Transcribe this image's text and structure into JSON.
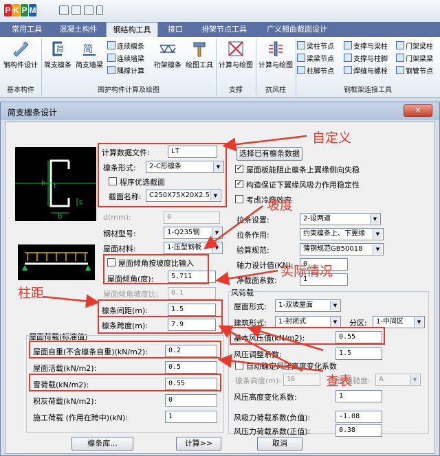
{
  "app": {
    "logo_letters": [
      "P",
      "K",
      "P",
      "M"
    ],
    "logo_colors": [
      "#d8262b",
      "#f4a21a",
      "#2d8d3a",
      "#1d5fb1"
    ],
    "tabs": [
      "常用工具",
      "混凝土构件",
      "钢结构工具",
      "接口",
      "排架节点工具",
      "广义翘曲截面设计"
    ],
    "active_tab": "钢结构工具"
  },
  "ribbon": {
    "buttons": {
      "steel_design": "钢构件设计",
      "simple_purlin": "简支檩条",
      "simple_wall_beam": "简支墙梁",
      "truss_purlin": "桁架檩条",
      "drawing_tool": "绘图工具",
      "calc_draw_1": "计算与绘图",
      "calc_draw_2": "计算与绘图"
    },
    "small_buttons": {
      "cont_purlin": "连续檩条",
      "cont_wall_beam": "连续墙梁",
      "corner_calc": "隅撑计算",
      "beam_col": "梁柱节点",
      "brace_beam": "支撑与梁柱",
      "portal_col": "门架梁柱",
      "beam_beam": "梁梁节点",
      "brace_foot": "支撑与柱脚",
      "portal_beam": "门架梁梁",
      "col_foot": "柱脚节点",
      "weld_bolt": "焊缝与螺栓",
      "steel_tube": "钢管节点"
    },
    "groups": [
      "基本构件",
      "围护构件计算及绘图",
      "支撑",
      "抗风柱",
      "钢框架连接工具"
    ]
  },
  "dialog": {
    "title": "简支檩条设计",
    "close": "✕",
    "preview": {
      "dim_b": "b",
      "dim_t": "t",
      "dim_h": "h",
      "dim_c": "c"
    },
    "calc_file_label": "计算数据文件:",
    "calc_file_value": "LT",
    "select_purlin_button": "选择已有檩条数据",
    "purlin_form_label": "檩条形式:",
    "purlin_form_value": "2-C形檩条",
    "optimize_section_label": "程序优选截面",
    "section_name_label": "截面名称:",
    "section_name_value": "C250X75X20X2.5",
    "roof_panel_label": "屋面板能阻止檩条上翼缘侧向失稳",
    "roof_panel_checked": "✓",
    "construction_label": "构造保证下翼缘风吸力作用稳定性",
    "construction_checked": "✓",
    "cold_bend_label": "考虑冷弯效应",
    "d_label": "d(mm):",
    "d_value": "0",
    "steel_grade_label": "钢材型号:",
    "steel_grade_value": "1-Q235钢",
    "roof_material_label": "屋面材料:",
    "roof_material_value": "1-压型钢板",
    "tie_setting_label": "拉条设置:",
    "tie_setting_value": "2-设两道",
    "tie_action_label": "拉条作用:",
    "tie_action_value": "约束檩条上、下翼缘",
    "code_label": "验算规范:",
    "code_value": "薄钢规范GB50018",
    "axial_label": "轴力设计值(KN):",
    "axial_value": "0",
    "net_section_label": "净截面系数:",
    "net_section_value": "1",
    "slope_ratio_check_label": "屋面倾角按坡度比输入",
    "slope_label": "屋面倾角(度):",
    "slope_value": "5.711",
    "slope_ratio_label": "屋面倾角坡度比:",
    "slope_ratio_value": "0.1",
    "purlin_spacing_label": "檩条间距(m):",
    "purlin_spacing_value": "1.5",
    "purlin_span_label": "檩条跨度(m):",
    "purlin_span_value": "7.9",
    "load_group_label": "屋面荷载(标准值)",
    "dead_load_label": "屋面自重(不含檩条自重)(kN/m2):",
    "dead_load_value": "0.2",
    "live_load_label": "屋面活载(kN/m2):",
    "live_load_value": "0.5",
    "snow_load_label": "雪荷载(kN/m2):",
    "snow_load_value": "0.55",
    "ash_load_label": "积灰荷载(kN/m2):",
    "ash_load_value": "0",
    "construction_load_label": "施工荷载 (作用在跨中)(kN):",
    "construction_load_value": "1",
    "wind_group_label": "风荷载",
    "roof_form_label": "屋面形式:",
    "roof_form_value": "1-双坡屋面",
    "building_form_label": "建筑形式:",
    "building_form_value": "1-封闭式",
    "zone_label": "分区:",
    "zone_value": "1-中间区",
    "basic_wind_label": "基本风压值(kN/m2):",
    "basic_wind_value": "0.55",
    "wind_adjust_label": "风压调整系数:",
    "wind_adjust_value": "1.5",
    "auto_height_label": "自动确定风压高度变化系数",
    "purlin_height_label": "檩条高度(m):",
    "purlin_height_value": "10",
    "terrain_label": "地面粗糙度:",
    "terrain_value": "A",
    "height_coef_label": "风压高度变化系数:",
    "height_coef_value": "1",
    "suction_label": "风吸力荷载系数(负值):",
    "suction_value": "-1.08",
    "pressure_label": "风压力荷载系数(正值):",
    "pressure_value": "0.38",
    "library_button": "檩条库...",
    "calc_button": "计算>>",
    "cancel_button": "取消"
  },
  "annotations": {
    "custom": "自定义",
    "slope": "坡度",
    "actual": "实际情况",
    "column_spacing": "柱距",
    "lookup": "查表",
    "color": "#e53a2c"
  }
}
